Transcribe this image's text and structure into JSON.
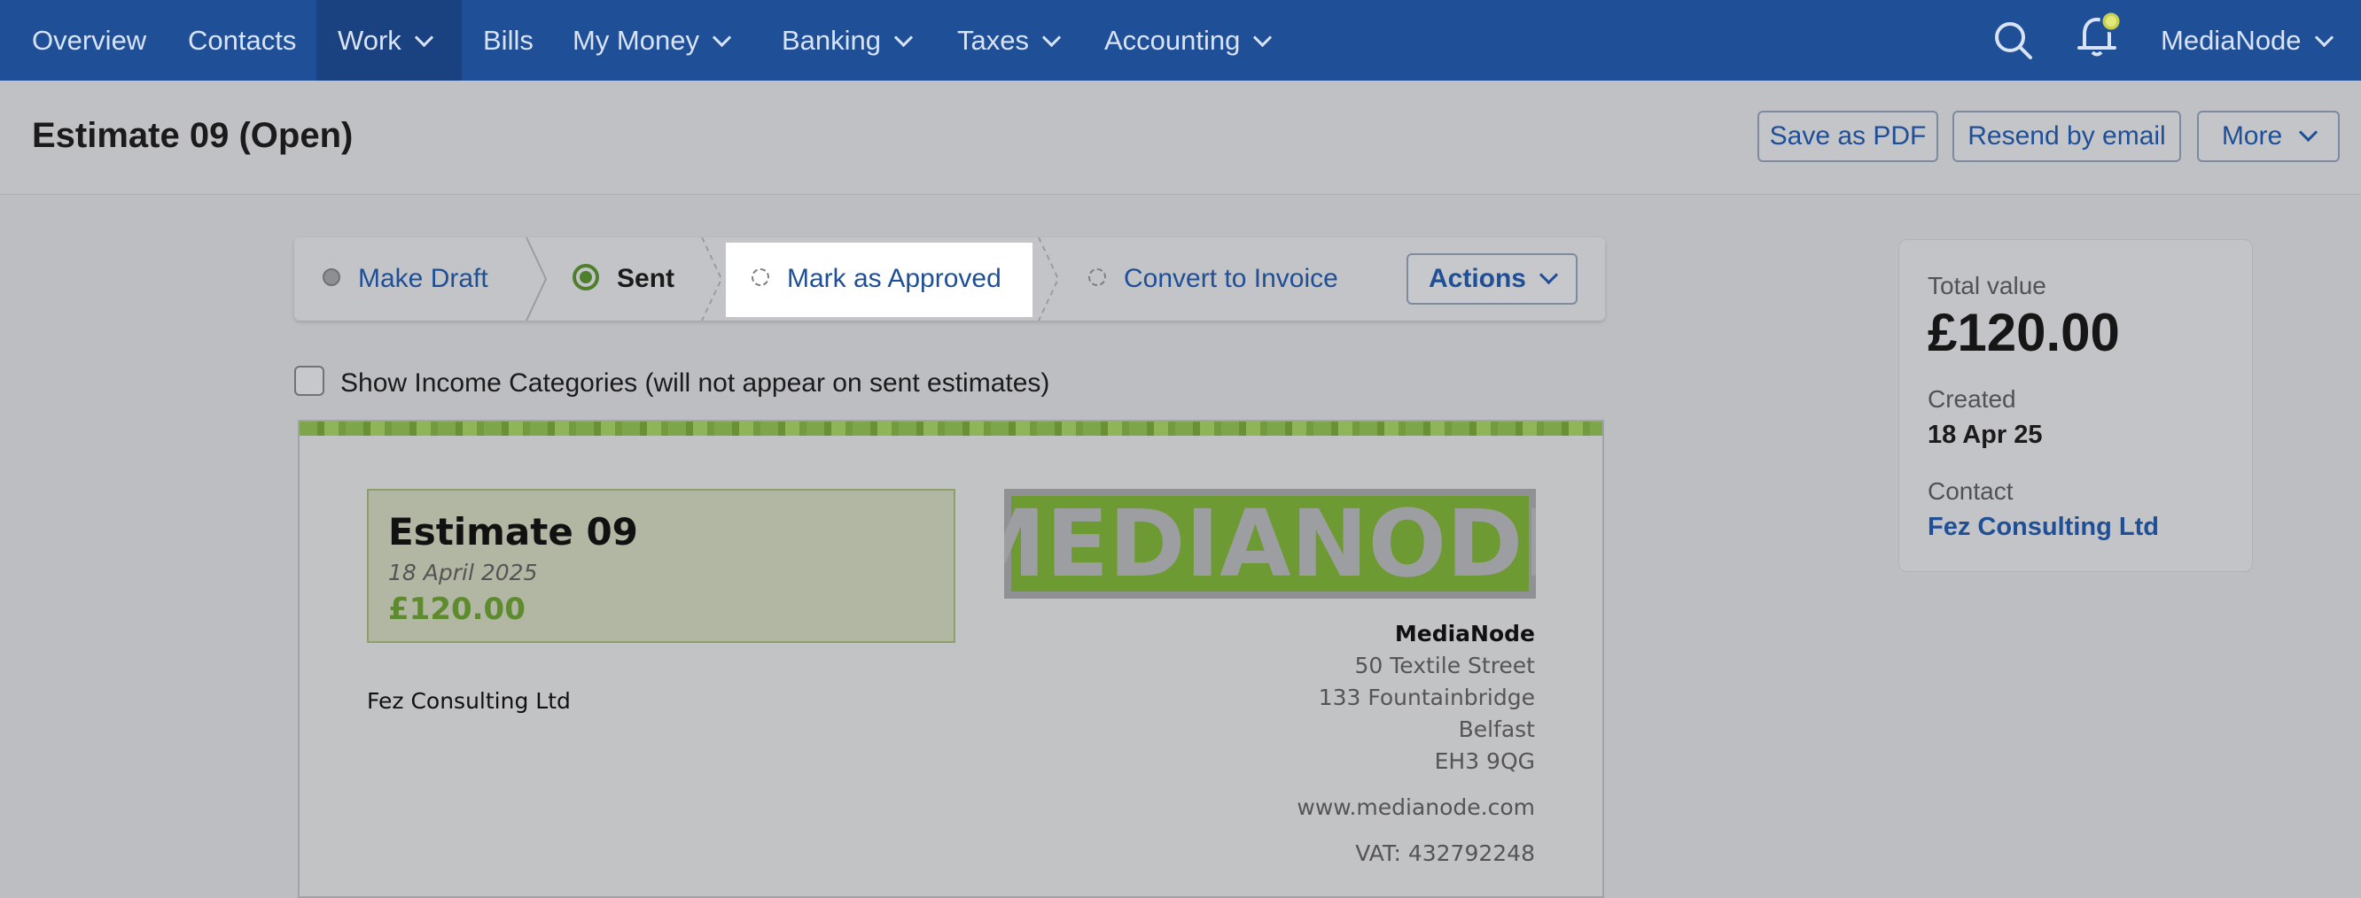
{
  "nav": {
    "items": [
      {
        "label": "Overview"
      },
      {
        "label": "Contacts"
      },
      {
        "label": "Work"
      },
      {
        "label": "Bills"
      },
      {
        "label": "My Money"
      },
      {
        "label": "Banking"
      },
      {
        "label": "Taxes"
      },
      {
        "label": "Accounting"
      }
    ],
    "active": "Work",
    "account_label": "MediaNode",
    "icons": [
      "search-icon",
      "notification-bell-icon",
      "chevron-down-icon"
    ]
  },
  "header": {
    "title": "Estimate 09 (Open)",
    "save_pdf_label": "Save as PDF",
    "resend_label": "Resend by email",
    "more_label": "More"
  },
  "status_bar": {
    "steps": [
      {
        "label": "Make Draft",
        "state": "done"
      },
      {
        "label": "Sent",
        "state": "current"
      },
      {
        "label": "Mark as Approved",
        "state": "pending"
      },
      {
        "label": "Convert to Invoice",
        "state": "pending"
      }
    ],
    "actions_label": "Actions"
  },
  "income_categories": {
    "label": "Show Income Categories (will not appear on sent estimates)",
    "checked": false
  },
  "document": {
    "estimate_title": "Estimate 09",
    "estimate_date": "18 April 2025",
    "estimate_total": "£120.00",
    "logo_text": "MEDIANODE",
    "client_name": "Fez Consulting Ltd",
    "company_name": "MediaNode",
    "address_lines": [
      "50 Textile Street",
      "133 Fountainbridge",
      "Belfast",
      "EH3 9QG"
    ],
    "website": "www.medianode.com",
    "vat": "VAT: 432792248"
  },
  "summary": {
    "total_label": "Total value",
    "total_value": "£120.00",
    "created_label": "Created",
    "created_value": "18 Apr 25",
    "contact_label": "Contact",
    "contact_value": "Fez Consulting Ltd"
  },
  "colors": {
    "nav_bg": "#1f4f97",
    "link": "#1f4f97",
    "accent_green": "#5e8b2d"
  }
}
